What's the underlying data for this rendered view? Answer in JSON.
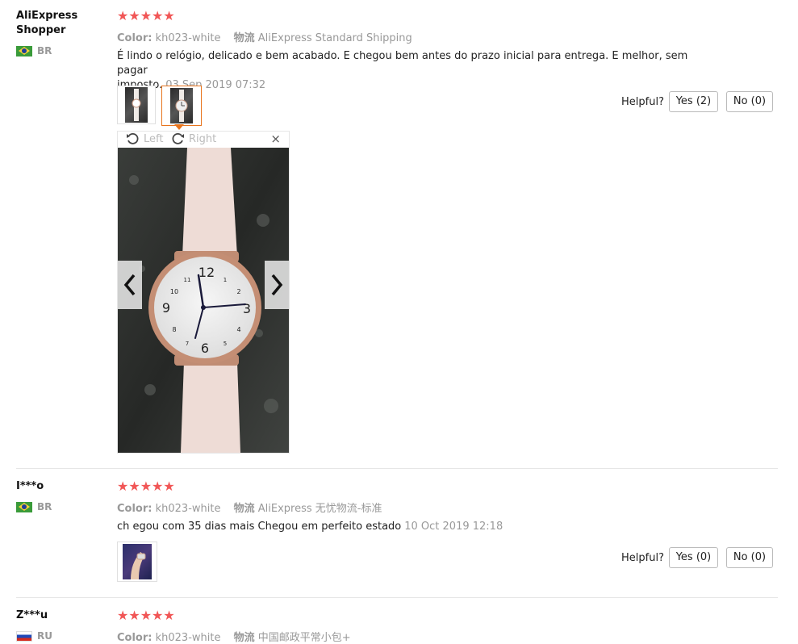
{
  "reviews": [
    {
      "user": "AliExpress Shopper",
      "country": "BR",
      "stars": "★★★★★",
      "color_label": "Color:",
      "color_value": "kh023-white",
      "shipping_label": "物流",
      "shipping_value": "AliExpress Standard Shipping",
      "text_line1": "É lindo o relógio, delicado e bem acabado. E chegou bem antes do prazo inicial para entrega. E melhor, sem pagar",
      "text_line2": "imposto.",
      "date": "03 Sep 2019 07:32",
      "helpful_label": "Helpful?",
      "yes_label": "Yes (2)",
      "no_label": "No (0)",
      "viewer": {
        "left_label": "Left",
        "right_label": "Right",
        "close_label": "×"
      }
    },
    {
      "user": "I***o",
      "country": "BR",
      "stars": "★★★★★",
      "color_label": "Color:",
      "color_value": "kh023-white",
      "shipping_label": "物流",
      "shipping_value": "AliExpress 无忧物流-标准",
      "text": "ch egou com 35 dias mais Chegou em perfeito estado",
      "date": "10 Oct 2019 12:18",
      "helpful_label": "Helpful?",
      "yes_label": "Yes (0)",
      "no_label": "No (0)"
    },
    {
      "user": "Z***u",
      "country": "RU",
      "stars": "★★★★★",
      "color_label": "Color:",
      "color_value": "kh023-white",
      "shipping_label": "物流",
      "shipping_value": "中国邮政平常小包+"
    }
  ],
  "colors": {
    "star": "#f15656",
    "accent": "#e8741d",
    "muted": "#999999"
  },
  "icons": [
    "rotate-left-icon",
    "rotate-right-icon",
    "close-icon",
    "chevron-left-icon",
    "chevron-right-icon",
    "flag-br-icon",
    "flag-ru-icon"
  ]
}
